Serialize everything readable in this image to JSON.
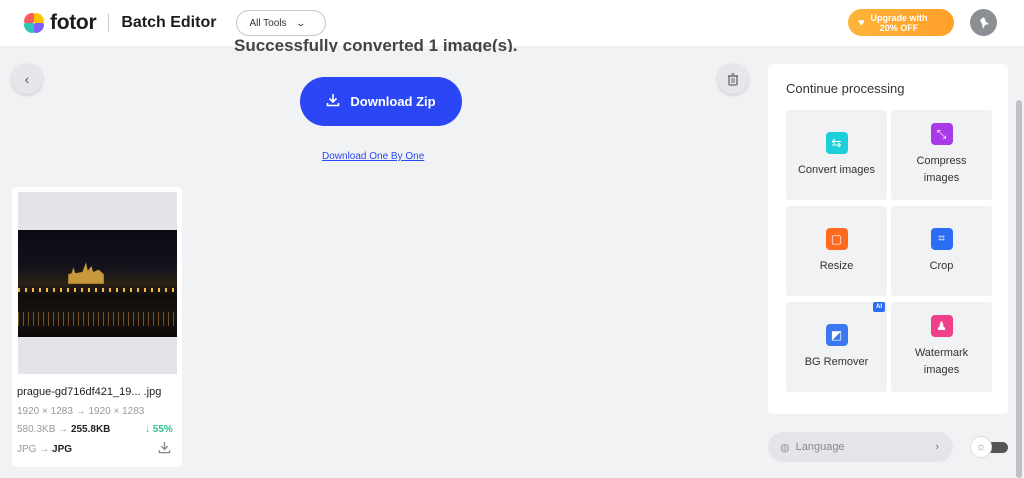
{
  "header": {
    "brand": "fotor",
    "app_title": "Batch Editor",
    "tools_label": "All Tools",
    "upgrade_line1": "Upgrade with",
    "upgrade_line2": "20% OFF"
  },
  "main": {
    "success_text": "Successfully converted 1 image(s).",
    "download_zip_label": "Download Zip",
    "download_one_label": "Download One By One"
  },
  "image_card": {
    "filename": "prague-gd716df421_19... .jpg",
    "dims_from": "1920 × 1283",
    "dims_to": "1920 × 1283",
    "size_from": "580.3KB",
    "size_to": "255.8KB",
    "reduction": "55%",
    "format_from": "JPG",
    "format_to": "JPG"
  },
  "panel": {
    "title": "Continue processing",
    "tools": [
      {
        "label": "Convert images",
        "icon": "convert-icon",
        "color": "#1ccfd9"
      },
      {
        "label": "Compress images",
        "icon": "compress-icon",
        "color": "#a93ae8"
      },
      {
        "label": "Resize",
        "icon": "resize-icon",
        "color": "#ff6a1f"
      },
      {
        "label": "Crop",
        "icon": "crop-icon",
        "color": "#2b6ef5"
      },
      {
        "label": "BG Remover",
        "icon": "bg-remover-icon",
        "color": "#3a78f2"
      },
      {
        "label": "Watermark images",
        "icon": "watermark-icon",
        "color": "#f0408a"
      }
    ],
    "ai_badge": "AI"
  },
  "footer": {
    "language_label": "Language"
  },
  "colors": {
    "primary": "#2b47f5",
    "upgrade": "#ffb43a",
    "success_green": "#2ec48b"
  }
}
